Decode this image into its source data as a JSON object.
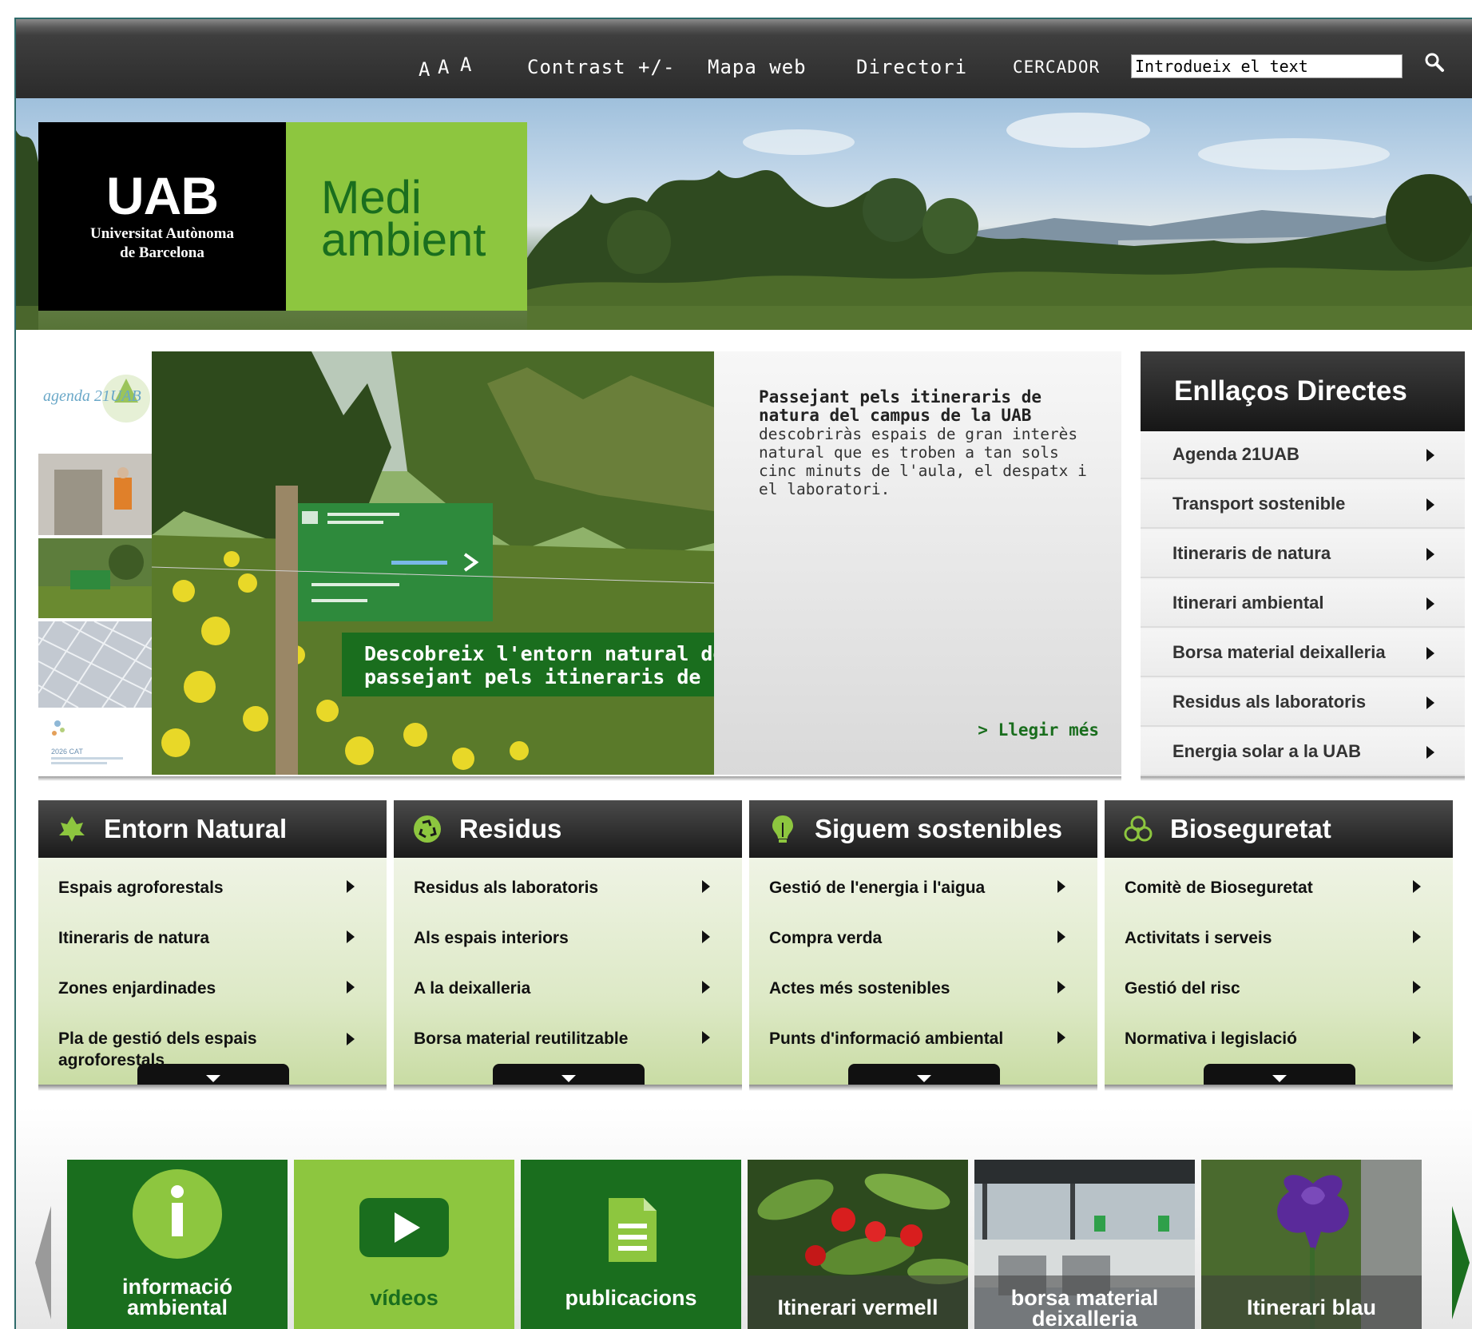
{
  "topbar": {
    "font_sizes": [
      "A",
      "A",
      "A"
    ],
    "contrast": "Contrast +/-",
    "sitemap": "Mapa web",
    "directory": "Directori",
    "search_label": "CERCADOR",
    "search_value": "Introdueix el text",
    "search_icon": "magnifier-icon"
  },
  "header": {
    "uab_mark": "UAB",
    "uab_name_1": "Universitat Autònoma",
    "uab_name_2": "de Barcelona",
    "site_name_1": "Medi",
    "site_name_2": "ambient"
  },
  "feature": {
    "thumbs": [
      "agenda 21UAB",
      "",
      "",
      "",
      "2026 CAT"
    ],
    "caption_1": "Descobreix l'entorn natural del campus de la UAB",
    "caption_2": "passejant pels itineraris de natura",
    "title": "Passejant pels itineraris de natura del campus de la UAB",
    "body": "descobriràs espais de gran interès natural que es troben a tan sols cinc minuts de l'aula, el despatx i el laboratori.",
    "read_more": "> Llegir més"
  },
  "direct_links": {
    "title": "Enllaços Directes",
    "items": [
      "Agenda 21UAB",
      "Transport sostenible",
      "Itineraris de natura",
      "Itinerari ambiental",
      "Borsa material deixalleria",
      "Residus als laboratoris",
      "Energia solar a la UAB"
    ]
  },
  "categories": [
    {
      "title": "Entorn Natural",
      "icon": "leaf-icon",
      "items": [
        "Espais agroforestals",
        "Itineraris de natura",
        "Zones enjardinades",
        "Pla de gestió dels espais agroforestals"
      ]
    },
    {
      "title": "Residus",
      "icon": "recycle-icon",
      "items": [
        "Residus als laboratoris",
        "Als espais interiors",
        "A la deixalleria",
        "Borsa material reutilitzable"
      ]
    },
    {
      "title": "Siguem sostenibles",
      "icon": "lightbulb-icon",
      "items": [
        "Gestió de l'energia i l'aigua",
        "Compra verda",
        "Actes més sostenibles",
        "Punts d'informació ambiental"
      ]
    },
    {
      "title": "Bioseguretat",
      "icon": "biohazard-icon",
      "items": [
        "Comitè de Bioseguretat",
        "Activitats i serveis",
        "Gestió del risc",
        "Normativa i legislació"
      ]
    }
  ],
  "carousel": {
    "tiles": [
      {
        "label_1": "informació",
        "label_2": "ambiental",
        "icon": "info-icon"
      },
      {
        "label_1": "vídeos",
        "icon": "play-icon"
      },
      {
        "label_1": "publicacions",
        "icon": "document-icon"
      },
      {
        "label_1": "Itinerari vermell",
        "icon": "berries-photo"
      },
      {
        "label_1": "borsa material",
        "label_2": "deixalleria",
        "icon": "waste-point-photo"
      },
      {
        "label_1": "Itinerari blau",
        "icon": "iris-photo"
      }
    ]
  },
  "colors": {
    "brand_green": "#1a6e1e",
    "light_green": "#8dc63f",
    "dark_bar": "#2b2b2b"
  }
}
